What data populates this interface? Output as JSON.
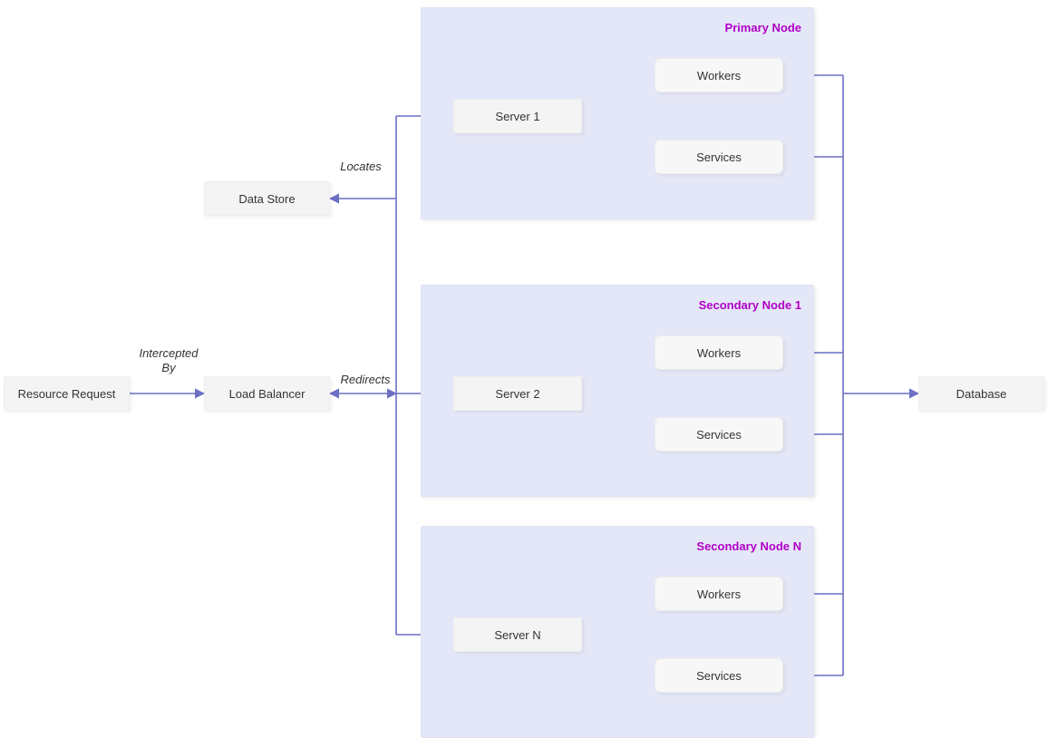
{
  "nodes": {
    "resource_request": "Resource Request",
    "load_balancer": "Load Balancer",
    "data_store": "Data Store",
    "database": "Database",
    "server1": "Server 1",
    "server2": "Server 2",
    "serverN": "Server N",
    "workers": "Workers",
    "services": "Services"
  },
  "groups": {
    "primary": "Primary Node",
    "secondary1": "Secondary Node 1",
    "secondaryN": "Secondary Node N"
  },
  "edges": {
    "intercepted_by": "Intercepted\nBy",
    "locates": "Locates",
    "redirects": "Redirects"
  },
  "colors": {
    "connector": "#6C6FC4",
    "group_bg": "#E4E7F7",
    "title": "#B100C8"
  }
}
